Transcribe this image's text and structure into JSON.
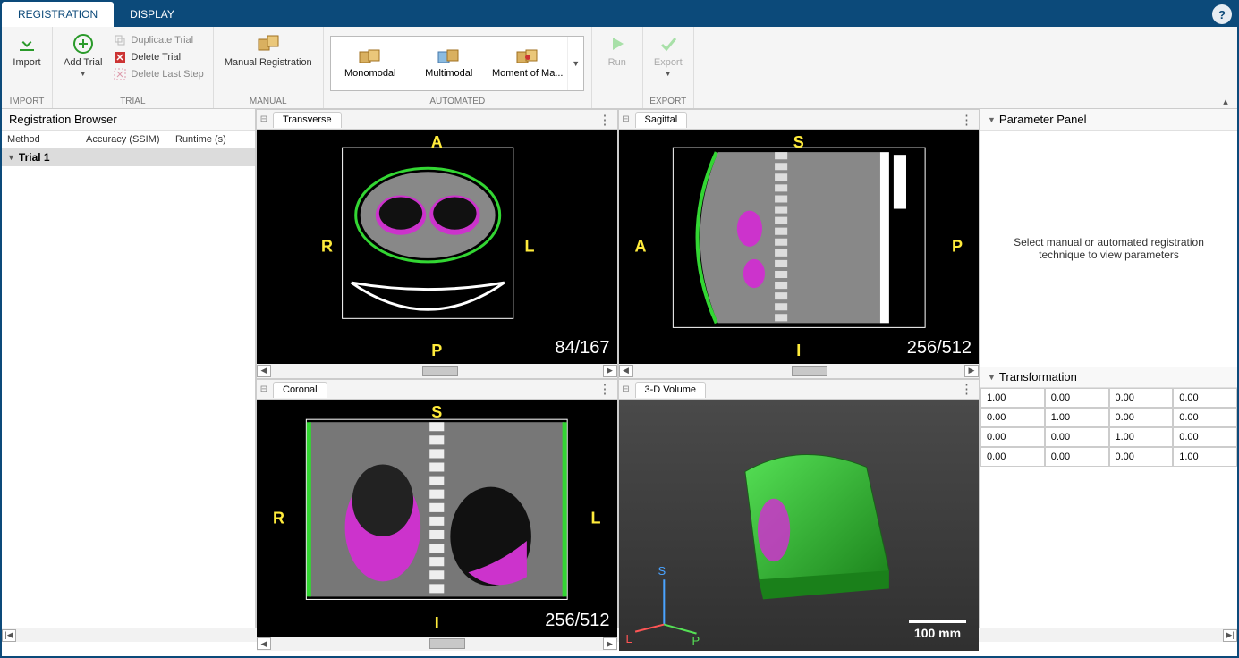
{
  "tabs": {
    "registration": "REGISTRATION",
    "display": "DISPLAY"
  },
  "ribbon": {
    "import": {
      "label": "Import",
      "group": "IMPORT"
    },
    "trial": {
      "addtrial": "Add Trial",
      "duplicate": "Duplicate Trial",
      "delete": "Delete Trial",
      "delete_step": "Delete Last Step",
      "group": "TRIAL"
    },
    "manual": {
      "label": "Manual Registration",
      "group": "MANUAL"
    },
    "automated": {
      "group": "AUTOMATED",
      "items": [
        "Monomodal",
        "Multimodal",
        "Moment of Ma..."
      ]
    },
    "run": "Run",
    "export": {
      "label": "Export",
      "group": "EXPORT"
    }
  },
  "browser": {
    "title": "Registration Browser",
    "cols": {
      "method": "Method",
      "accuracy": "Accuracy (SSIM)",
      "runtime": "Runtime (s)"
    },
    "trial": "Trial 1"
  },
  "views": {
    "transverse": {
      "name": "Transverse",
      "top": "A",
      "bottom": "P",
      "left": "R",
      "right": "L",
      "slice": "84/167"
    },
    "sagittal": {
      "name": "Sagittal",
      "top": "S",
      "bottom": "I",
      "left": "A",
      "right": "P",
      "slice": "256/512"
    },
    "coronal": {
      "name": "Coronal",
      "top": "S",
      "bottom": "I",
      "left": "R",
      "right": "L",
      "slice": "256/512"
    },
    "volume": {
      "name": "3-D Volume",
      "axis": {
        "s": "S",
        "l": "L",
        "p": "P"
      },
      "scalebar": "100 mm"
    }
  },
  "param_panel": {
    "title": "Parameter Panel",
    "hint": "Select manual or automated registration technique to view parameters"
  },
  "transformation": {
    "title": "Transformation",
    "matrix": [
      [
        "1.00",
        "0.00",
        "0.00",
        "0.00"
      ],
      [
        "0.00",
        "1.00",
        "0.00",
        "0.00"
      ],
      [
        "0.00",
        "0.00",
        "1.00",
        "0.00"
      ],
      [
        "0.00",
        "0.00",
        "0.00",
        "1.00"
      ]
    ]
  },
  "colors": {
    "accent": "#0c4a7a",
    "orient": "#ffeb3b",
    "vol_green": "#33d633",
    "vol_mag": "#cc33cc"
  }
}
